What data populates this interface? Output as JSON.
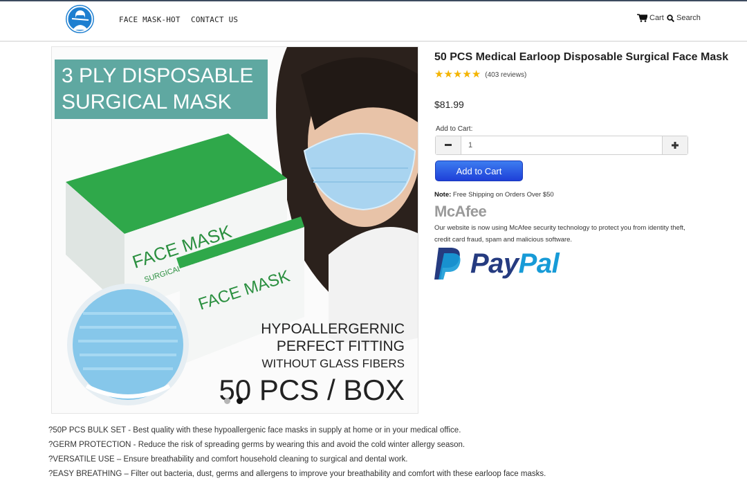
{
  "nav": {
    "logo_icon": "mask-person-icon",
    "links": [
      {
        "label": "FACE MASK-HOT"
      },
      {
        "label": "CONTACT US"
      }
    ],
    "cart_label": "Cart",
    "search_label": "Search"
  },
  "gallery": {
    "banner_text_line1": "3 PLY DISPOSABLE",
    "banner_text_line2": "SURGICAL MASK",
    "box_text": "FACE MASK",
    "box_subtext": "SURGICAL DISPOSABLE",
    "box_count": "50 PCS",
    "feature_line1": "HYPOALLERGERNIC",
    "feature_line2": "PERFECT FITTING",
    "feature_line3": "WITHOUT GLASS FIBERS",
    "big_count": "50 PCS / BOX",
    "active_slide": 2,
    "slide_count": 2
  },
  "product": {
    "title": "50 PCS Medical Earloop Disposable Surgical Face Mask",
    "rating": 5,
    "reviews": "(403 reviews)",
    "price": "$81.99",
    "add_to_cart_label": "Add to Cart:",
    "quantity": "1",
    "add_button": "Add to Cart",
    "note_label": "Note:",
    "note_text": " Free Shipping on Orders Over $50",
    "mcafee_logo": "McAfee",
    "mcafee_text": "Our website is now using McAfee security technology to protect you from identity theft, credit card fraud, spam and malicious software.",
    "paypal_label": "PayPal",
    "colors": {
      "star": "#f4b400",
      "button": "#2b55e3",
      "paypal_dark": "#253b80",
      "paypal_light": "#179bd7"
    }
  },
  "features": [
    "?50P PCS BULK SET - Best quality with these hypoallergenic face masks in supply at home or in your medical office.",
    "?GERM PROTECTION - Reduce the risk of spreading germs by wearing this and avoid the cold winter allergy season.",
    "?VERSATILE USE – Ensure breathability and comfort household cleaning to surgical and dental work.",
    "?EASY BREATHING – Filter out bacteria, dust, germs and allergens to improve your breathability and comfort with these earloop face masks."
  ]
}
